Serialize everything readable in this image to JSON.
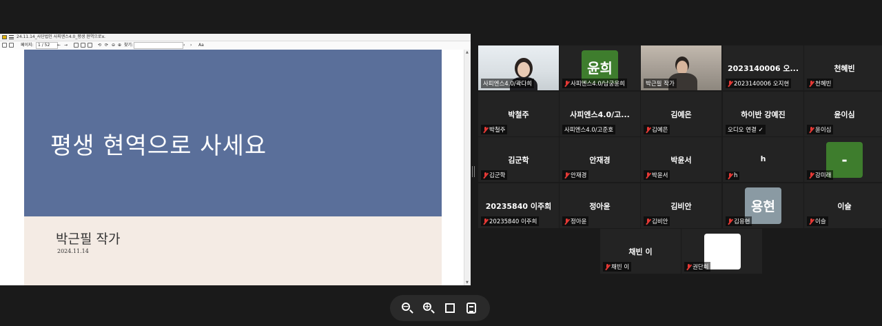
{
  "viewer": {
    "tab_title": "24.11.14_사단법인 사피엔스4.0_평생 현역으로...",
    "tab_close": "×",
    "page_label": "페이지:",
    "page_current": "1 / 52",
    "find_label": "찾기:",
    "aa_label": "Aa"
  },
  "slide": {
    "title": "평생 현역으로 사세요",
    "author": "박근필 작가",
    "date": "2024.11.14"
  },
  "participants": [
    {
      "big": "",
      "label": "사피엔스4.0/곽다희",
      "muted": false,
      "type": "video1"
    },
    {
      "big": "윤희",
      "label": "사피엔스4.0/남궁윤희",
      "muted": true,
      "type": "avatar",
      "color": "#3e7d2d"
    },
    {
      "big": "",
      "label": "박근필 작가",
      "muted": false,
      "type": "video3"
    },
    {
      "big": "2023140006 오...",
      "label": "2023140006 오지현",
      "muted": true,
      "type": "name"
    },
    {
      "big": "천혜빈",
      "label": "천혜빈",
      "muted": true,
      "type": "name"
    },
    {
      "big": "박철주",
      "label": "박철주",
      "muted": true,
      "type": "name"
    },
    {
      "big": "사피엔스4.0/고...",
      "label": "사피엔스4.0/고준호",
      "muted": false,
      "type": "name"
    },
    {
      "big": "김예은",
      "label": "김예은",
      "muted": true,
      "type": "name"
    },
    {
      "big": "하이반 강예진",
      "label": "오디오 연결 ✓",
      "muted": false,
      "type": "name"
    },
    {
      "big": "윤이심",
      "label": "윤이심",
      "muted": true,
      "type": "name"
    },
    {
      "big": "김군학",
      "label": "김군학",
      "muted": true,
      "type": "name"
    },
    {
      "big": "안재경",
      "label": "안재경",
      "muted": true,
      "type": "name"
    },
    {
      "big": "박윤서",
      "label": "박윤서",
      "muted": true,
      "type": "name"
    },
    {
      "big": "h",
      "label": "h",
      "muted": true,
      "type": "name"
    },
    {
      "big": "-",
      "label": "강미래",
      "muted": true,
      "type": "avatar",
      "color": "#3e7d2d"
    },
    {
      "big": "20235840 이주희",
      "label": "20235840 이주희",
      "muted": true,
      "type": "name"
    },
    {
      "big": "정아윤",
      "label": "정아윤",
      "muted": true,
      "type": "name"
    },
    {
      "big": "김비안",
      "label": "김비안",
      "muted": true,
      "type": "name"
    },
    {
      "big": "용현",
      "label": "김용현",
      "muted": true,
      "type": "avatar",
      "color": "#8a9aa3"
    },
    {
      "big": "이슬",
      "label": "이슬",
      "muted": true,
      "type": "name"
    },
    {
      "big": "채빈 이",
      "label": "채빈 이",
      "muted": true,
      "type": "name"
    },
    {
      "big": "",
      "label": "권단희",
      "muted": true,
      "type": "avatar",
      "color": "#ffffff"
    }
  ],
  "controls": {
    "zoom_out": "zoom-out-icon",
    "zoom_in": "zoom-in-icon",
    "fullscreen": "fullscreen-icon",
    "notes": "notes-icon"
  },
  "colors": {
    "background": "#1a1a1a",
    "tile": "#232323",
    "active_border": "#2ecc71",
    "muted_red": "#e53935",
    "slide_blue": "#5a6f9a",
    "slide_cream": "#f4ebe4"
  }
}
